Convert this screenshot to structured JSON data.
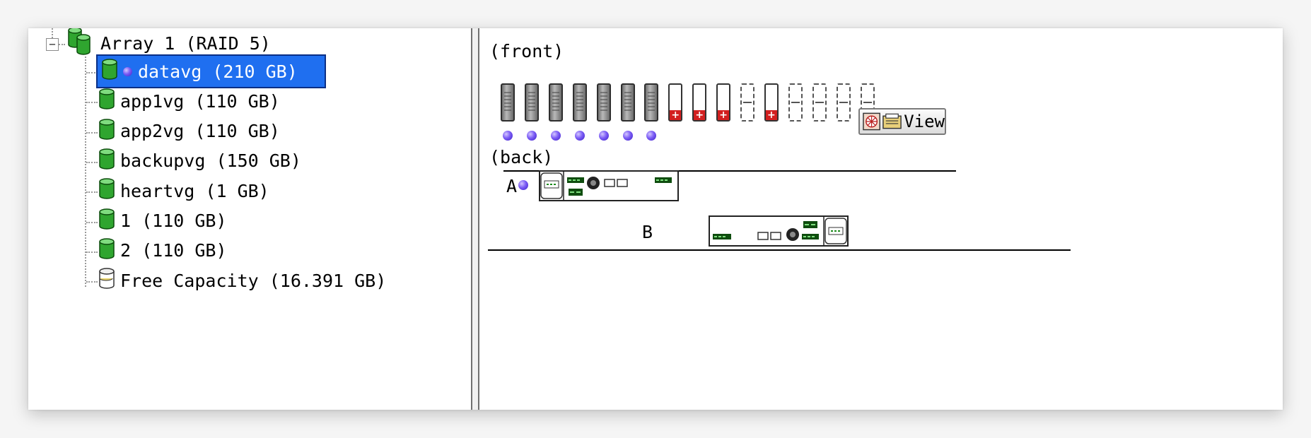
{
  "tree": {
    "array": {
      "label": "Array 1 (RAID 5)",
      "expander": "−"
    },
    "items": [
      {
        "label": "datavg (210 GB)",
        "icon": "logical-drive-icon",
        "selected": true,
        "led": true
      },
      {
        "label": "app1vg (110 GB)",
        "icon": "logical-drive-icon"
      },
      {
        "label": "app2vg (110 GB)",
        "icon": "logical-drive-icon"
      },
      {
        "label": "backupvg (150 GB)",
        "icon": "logical-drive-icon"
      },
      {
        "label": "heartvg (1 GB)",
        "icon": "logical-drive-icon"
      },
      {
        "label": "1 (110 GB)",
        "icon": "logical-drive-icon"
      },
      {
        "label": "2 (110 GB)",
        "icon": "logical-drive-icon"
      },
      {
        "label": "Free Capacity (16.391 GB)",
        "icon": "free-capacity-icon"
      }
    ]
  },
  "enclosure": {
    "front_label": "(front)",
    "back_label": "(back)",
    "slots": [
      "assigned",
      "assigned",
      "assigned",
      "assigned",
      "assigned",
      "assigned",
      "assigned",
      "unassigned",
      "unassigned",
      "unassigned",
      "empty",
      "unassigned",
      "empty",
      "empty",
      "empty",
      "empty"
    ],
    "slot_leds": 7,
    "view_button_label": "View",
    "controllers": [
      {
        "label": "A",
        "led": true
      },
      {
        "label": "B",
        "led": false
      }
    ]
  },
  "colors": {
    "selection": "#1f6ff0",
    "drive_green": "#1f9a1f",
    "led_purple": "#6a4ef0",
    "unassigned_red": "#d21f1f"
  }
}
